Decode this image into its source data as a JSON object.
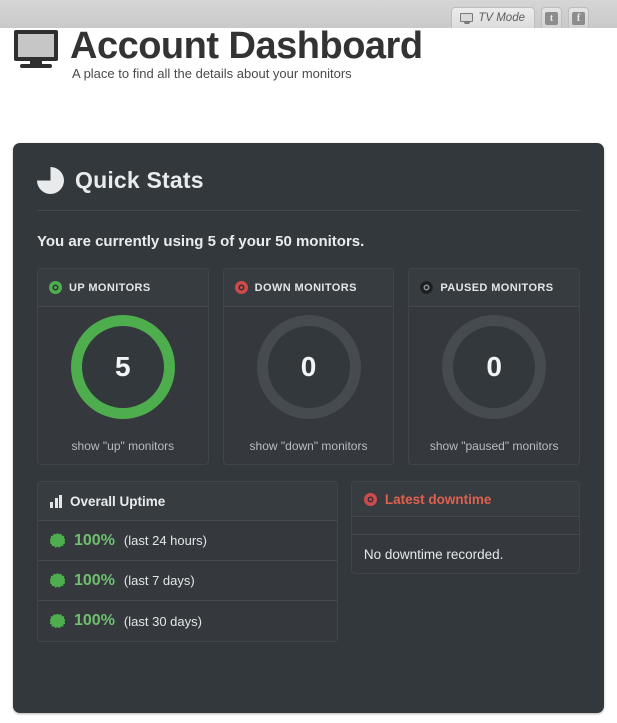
{
  "topbar": {
    "tv_mode_label": "TV Mode",
    "tv_mode_icon": "monitor-icon",
    "social": [
      {
        "name": "twitter",
        "glyph": "t"
      },
      {
        "name": "facebook",
        "glyph": "f"
      }
    ]
  },
  "header": {
    "logo_icon": "monitor-icon",
    "title": "Account Dashboard",
    "subtitle": "A place to find all the details about your monitors"
  },
  "panel": {
    "icon": "pie-chart-icon",
    "title": "Quick Stats",
    "usage_text": "You are currently using 5 of your 50 monitors."
  },
  "cards": [
    {
      "key": "up",
      "icon": "green-circle-icon",
      "head_label": "UP MONITORS",
      "value": "5",
      "ring_color": "#4eae4e",
      "link_label": "show \"up\" monitors"
    },
    {
      "key": "down",
      "icon": "red-circle-icon",
      "head_label": "DOWN MONITORS",
      "value": "0",
      "ring_color": "#464b50",
      "link_label": "show \"down\" monitors"
    },
    {
      "key": "paused",
      "icon": "black-circle-icon",
      "head_label": "PAUSED MONITORS",
      "value": "0",
      "ring_color": "#464b50",
      "link_label": "show \"paused\" monitors"
    }
  ],
  "uptime": {
    "icon": "bar-chart-icon",
    "head_label": "Overall Uptime",
    "rows": [
      {
        "badge": "star-badge-icon",
        "percent": "100%",
        "period": "(last 24 hours)"
      },
      {
        "badge": "star-badge-icon",
        "percent": "100%",
        "period": "(last 7 days)"
      },
      {
        "badge": "star-badge-icon",
        "percent": "100%",
        "period": "(last 30 days)"
      }
    ]
  },
  "downtime": {
    "icon": "red-circle-icon",
    "head_label": "Latest downtime",
    "body_text": "No downtime recorded."
  },
  "colors": {
    "accent_green": "#4eae4e",
    "accent_red": "#cf4a4a",
    "panel_bg": "#33383c",
    "card_bg": "#35393e"
  }
}
